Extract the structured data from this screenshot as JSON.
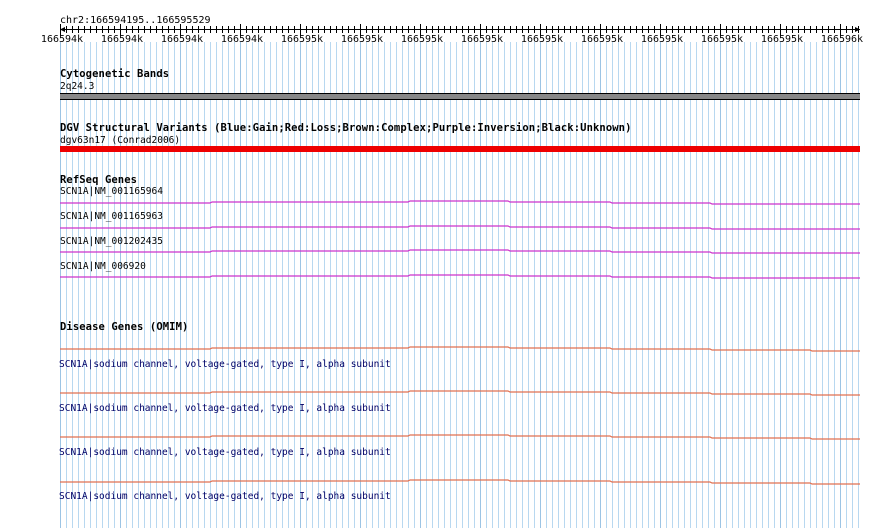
{
  "ruler": {
    "coordinates": "chr2:166594195..166595529",
    "tick_labels": [
      "166594k",
      "166594k",
      "166594k",
      "166594k",
      "166595k",
      "166595k",
      "166595k",
      "166595k",
      "166595k",
      "166595k",
      "166595k",
      "166595k",
      "166595k",
      "166596k"
    ]
  },
  "tracks": {
    "cytoband": {
      "title": "Cytogenetic Bands",
      "band_label": "2q24.3",
      "color": "#888888"
    },
    "dgv": {
      "title": "DGV Structural Variants (Blue:Gain;Red:Loss;Brown:Complex;Purple:Inversion;Black:Unknown)",
      "feature_label": "dgv63n17 (Conrad2006)",
      "color": "#ee0000"
    },
    "refseq": {
      "title": "RefSeq Genes",
      "color": "#cc33cc",
      "genes": [
        {
          "label": "SCN1A|NM_001165964"
        },
        {
          "label": "SCN1A|NM_001165963"
        },
        {
          "label": "SCN1A|NM_001202435"
        },
        {
          "label": "SCN1A|NM_006920"
        }
      ]
    },
    "omim": {
      "title": "Disease Genes (OMIM)",
      "color": "#e07050",
      "genes": [
        {
          "label": "SCN1A|sodium channel, voltage-gated, type I, alpha subunit"
        },
        {
          "label": "SCN1A|sodium channel, voltage-gated, type I, alpha subunit"
        },
        {
          "label": "SCN1A|sodium channel, voltage-gated, type I, alpha subunit"
        },
        {
          "label": "SCN1A|sodium channel, voltage-gated, type I, alpha subunit"
        }
      ]
    }
  },
  "colors": {
    "grid_line": "#b8d8f0",
    "ruler": "#000000"
  }
}
